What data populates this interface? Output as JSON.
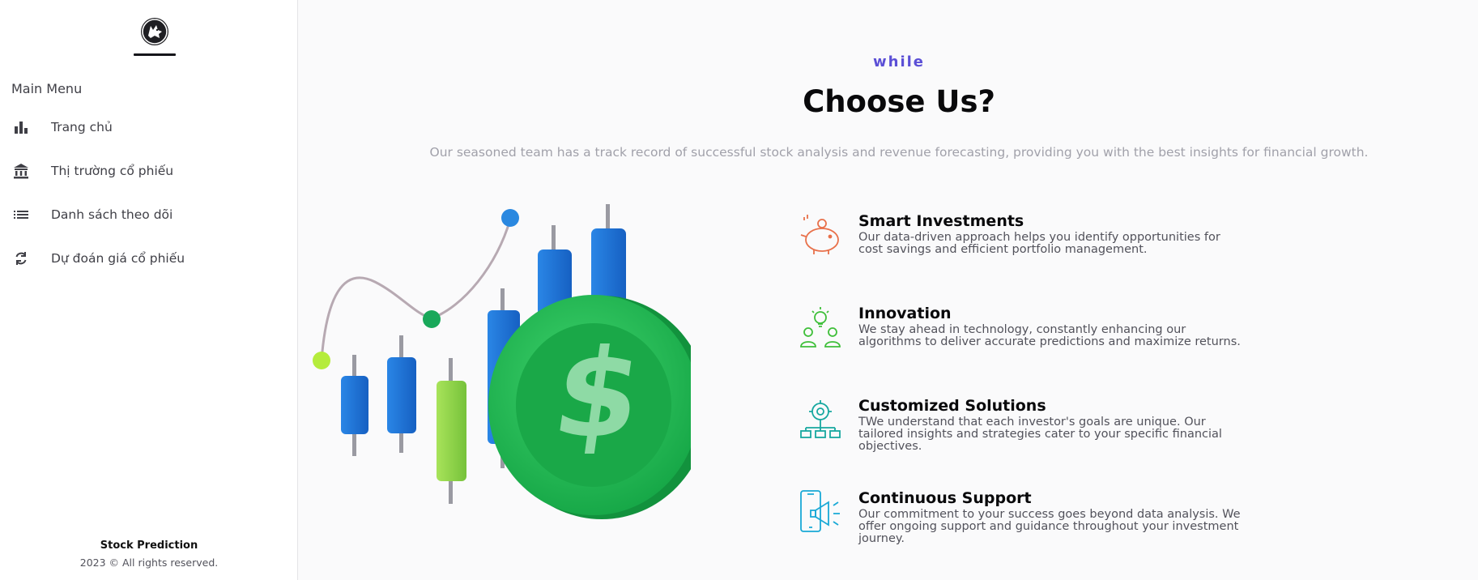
{
  "sidebar": {
    "menu_heading": "Main Menu",
    "items": [
      {
        "label": "Trang chủ",
        "icon": "bar-chart-icon"
      },
      {
        "label": "Thị trường cổ phiếu",
        "icon": "bank-icon"
      },
      {
        "label": "Danh sách theo dõi",
        "icon": "list-icon"
      },
      {
        "label": "Dự đoán giá cổ phiếu",
        "icon": "refresh-icon"
      }
    ],
    "footer": {
      "title": "Stock Prediction",
      "copyright": "2023 © All rights reserved."
    }
  },
  "hero": {
    "eyebrow": "while",
    "title": "Choose Us?",
    "subtitle": "Our seasoned team has a track record of successful stock analysis and revenue forecasting, providing you with the best insights for financial growth."
  },
  "features": [
    {
      "title": "Smart Investments",
      "description": "Our data-driven approach helps you identify opportunities for cost savings and efficient portfolio management.",
      "icon": "piggy-bank-icon",
      "color": "#e8704a"
    },
    {
      "title": "Innovation",
      "description": "We stay ahead in technology, constantly enhancing our algorithms to deliver accurate predictions and maximize returns.",
      "icon": "team-idea-icon",
      "color": "#3fbf3a"
    },
    {
      "title": "Customized Solutions",
      "description": "TWe understand that each investor's goals are unique. Our tailored insights and strategies cater to your specific financial objectives.",
      "icon": "gear-network-icon",
      "color": "#17a8a0"
    },
    {
      "title": "Continuous Support",
      "description": "Our commitment to your success goes beyond data analysis. We offer ongoing support and guidance throughout your investment journey.",
      "icon": "mobile-megaphone-icon",
      "color": "#19a9d6"
    }
  ],
  "colors": {
    "accent": "#5b4fd6",
    "candle_blue": "#1f74d6",
    "candle_green": "#8fd24a",
    "coin_green": "#1fb24e"
  }
}
